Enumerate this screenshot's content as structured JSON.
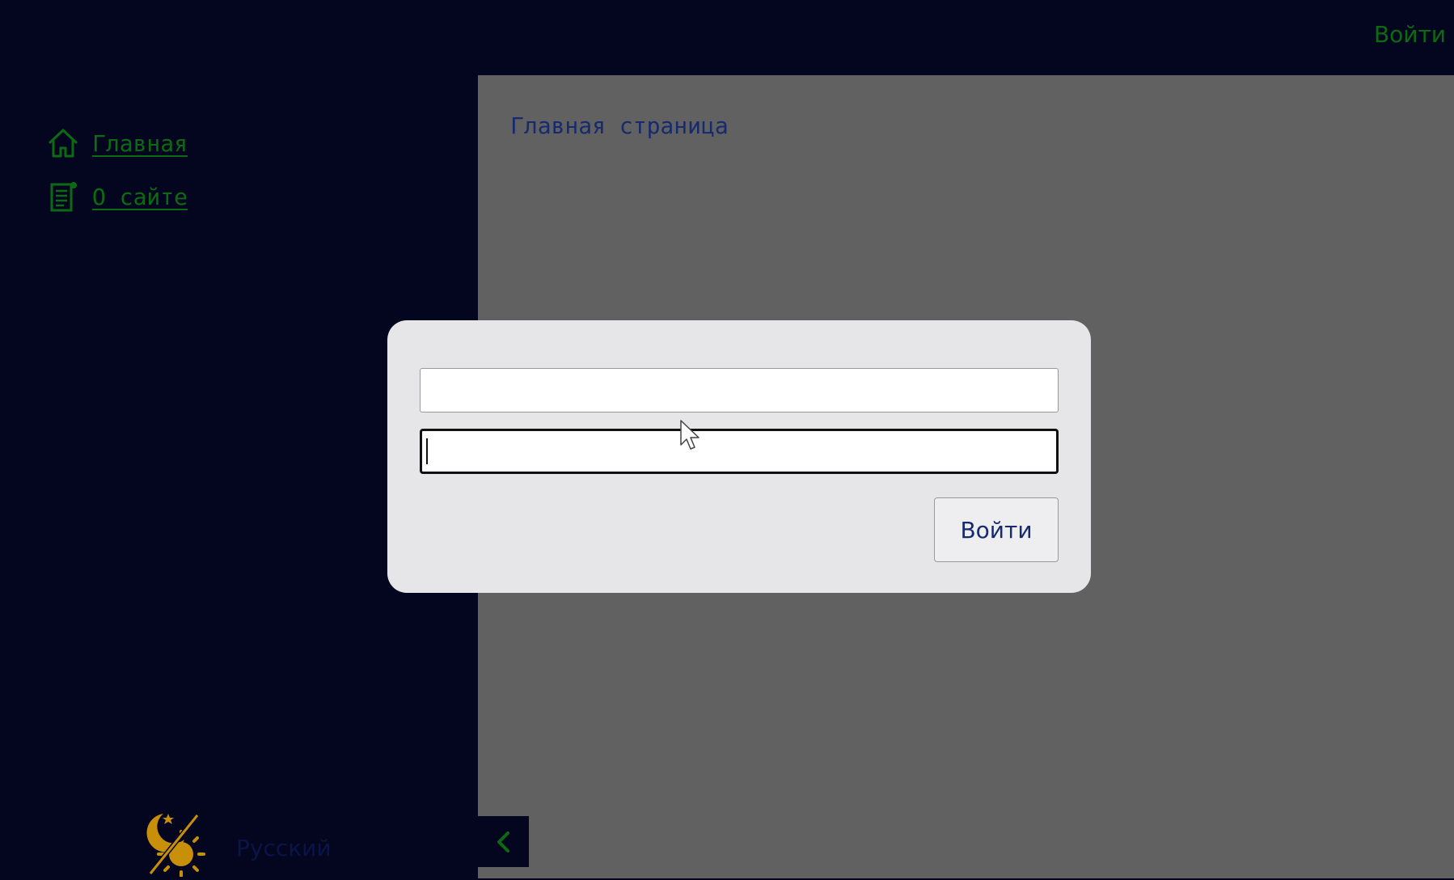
{
  "header": {
    "login_link": "Войти"
  },
  "sidebar": {
    "items": [
      {
        "label": "Главная",
        "icon": "home-icon"
      },
      {
        "label": "О сайте",
        "icon": "document-icon"
      }
    ],
    "language": "Русский",
    "theme_toggle_icon": "moon-sun-icon",
    "collapse_icon": "chevron-left-icon"
  },
  "main": {
    "title": "Главная страница"
  },
  "login_dialog": {
    "username_value": "",
    "password_value": "",
    "submit_label": "Войти"
  },
  "colors": {
    "background": "#040620",
    "link_green": "#0c6b12",
    "main_gray": "#616161",
    "dialog": "#e6e5e7",
    "text_blue": "#172a6e",
    "sun_gold": "#c88f0a"
  }
}
